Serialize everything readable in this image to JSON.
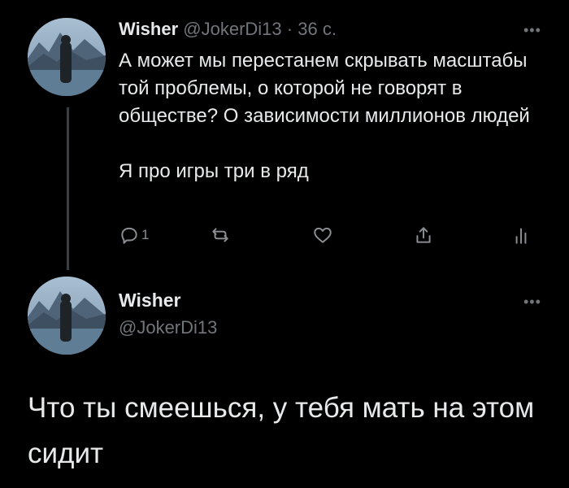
{
  "tweet1": {
    "author_name": "Wisher",
    "handle": "@JokerDi13",
    "separator": "·",
    "time": "36 с.",
    "text_paragraph1": "А может мы перестанем скрывать масштабы той проблемы, о которой не говорят в обществе? О зависимости миллионов людей",
    "text_paragraph2": "Я про игры три в ряд",
    "more_icon": "ellipsis-icon",
    "actions": {
      "reply_count": "1",
      "reply_icon": "reply-icon",
      "retweet_icon": "retweet-icon",
      "like_icon": "heart-icon",
      "share_icon": "share-icon",
      "analytics_icon": "analytics-icon"
    }
  },
  "tweet2": {
    "author_name": "Wisher",
    "handle": "@JokerDi13",
    "text": "Что ты смеешься, у тебя мать на этом сидит",
    "more_icon": "ellipsis-icon"
  },
  "colors": {
    "background": "#000000",
    "text_primary": "#e7e9ea",
    "text_secondary": "#71767b",
    "thread_line": "#3a3f44"
  }
}
